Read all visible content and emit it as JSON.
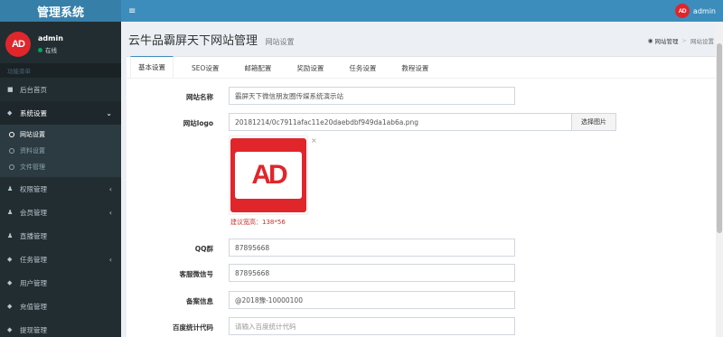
{
  "sidebar": {
    "app_title": "管理系统",
    "avatar_text": "AD",
    "user_name": "admin",
    "user_status": "在线",
    "section_label": "功能菜单",
    "items": [
      {
        "label": "后台首页",
        "icon": "home-icon",
        "glyph": "■"
      },
      {
        "label": "系统设置",
        "icon": "dashboard-icon",
        "glyph": "◆",
        "chevron": "⌄"
      },
      {
        "label": "权限管理",
        "icon": "users-icon",
        "glyph": "♟",
        "chevron": "‹"
      },
      {
        "label": "会员管理",
        "icon": "users-icon",
        "glyph": "♟",
        "chevron": "‹"
      },
      {
        "label": "直播管理",
        "icon": "users-icon",
        "glyph": "♟"
      },
      {
        "label": "任务管理",
        "icon": "dashboard-icon",
        "glyph": "◆",
        "chevron": "‹"
      },
      {
        "label": "用户管理",
        "icon": "dashboard-icon",
        "glyph": "◆"
      },
      {
        "label": "充值管理",
        "icon": "dashboard-icon",
        "glyph": "◆"
      },
      {
        "label": "提现管理",
        "icon": "dashboard-icon",
        "glyph": "◆"
      }
    ],
    "sub_items": [
      {
        "label": "网站设置",
        "active": true
      },
      {
        "label": "资料设置",
        "active": false
      },
      {
        "label": "文件管理",
        "active": false
      }
    ]
  },
  "topbar": {
    "menu_glyph": "≡",
    "avatar_text": "AD",
    "user_name": "admin"
  },
  "header": {
    "title": "云牛品霸屏天下网站管理",
    "subtitle": "网站设置",
    "breadcrumb": [
      "网站管理",
      "网站设置"
    ]
  },
  "tabs": [
    "基本设置",
    "SEO设置",
    "邮箱配置",
    "奖励设置",
    "任务设置",
    "教程设置"
  ],
  "form": {
    "site_name_label": "网站名称",
    "site_name_value": "霸屏天下微信朋友圈传媒系统演示站",
    "logo_label": "网站logo",
    "logo_value": "20181214/0c7911afac11e20daebdbf949da1ab6a.png",
    "pick_button": "选择图片",
    "logo_preview_text": "AD",
    "close_glyph": "×",
    "hint": "建议宽高：138*56",
    "qq_label": "QQ群",
    "qq_value": "87895668",
    "wechat_label": "客服微信号",
    "wechat_value": "87895668",
    "icp_label": "备案信息",
    "icp_value": "@2018豫-10000100",
    "baidu_label": "百度统计代码",
    "baidu_placeholder": "请输入百度统计代码"
  }
}
